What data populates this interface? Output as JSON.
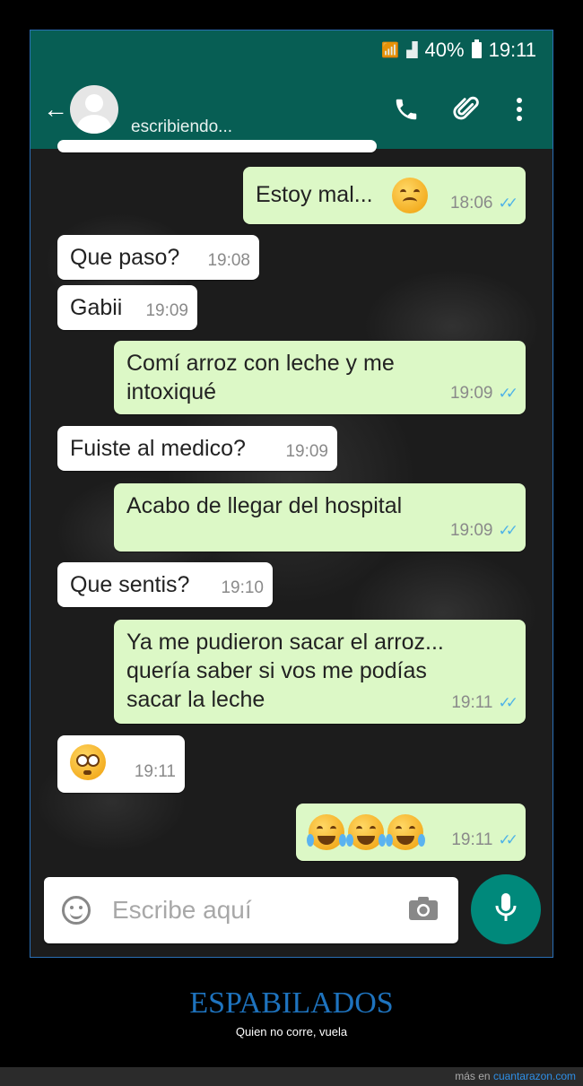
{
  "status_bar": {
    "battery": "40%",
    "time": "19:11"
  },
  "header": {
    "status": "escribiendo..."
  },
  "messages": [
    {
      "direction": "out",
      "text": "Estoy mal...",
      "emoji": "disappointed-face",
      "time": "18:06",
      "read": true
    },
    {
      "direction": "in",
      "text": "Que paso?",
      "time": "19:08"
    },
    {
      "direction": "in",
      "text": "Gabii",
      "time": "19:09"
    },
    {
      "direction": "out",
      "lines": [
        "Comí arroz con leche y me",
        "intoxiqué"
      ],
      "time": "19:09",
      "read": true
    },
    {
      "direction": "in",
      "text": "Fuiste al medico?",
      "time": "19:09"
    },
    {
      "direction": "out",
      "text": "Acabo de llegar del hospital",
      "time": "19:09",
      "read": true
    },
    {
      "direction": "in",
      "text": "Que sentis?",
      "time": "19:10"
    },
    {
      "direction": "out",
      "lines": [
        "Ya me pudieron sacar el arroz...",
        "quería saber si vos me podías",
        "sacar la leche"
      ],
      "time": "19:11",
      "read": true
    },
    {
      "direction": "in",
      "emoji": "flushed-face",
      "time": "19:11"
    },
    {
      "direction": "out",
      "emoji": "tears-of-joy-face x3",
      "time": "19:11",
      "read": true
    }
  ],
  "composer": {
    "placeholder": "Escribe aquí"
  },
  "caption": {
    "title": "ESPABILADOS",
    "subtitle": "Quien no corre, vuela"
  },
  "footer": {
    "prefix": "más en",
    "link": "cuantarazon.com"
  },
  "colors": {
    "header": "#075e54",
    "outgoing_bubble": "#dcf8c6",
    "incoming_bubble": "#ffffff",
    "mic_button": "#00897b",
    "read_ticks": "#4fb3e7",
    "title": "#1e73be"
  }
}
